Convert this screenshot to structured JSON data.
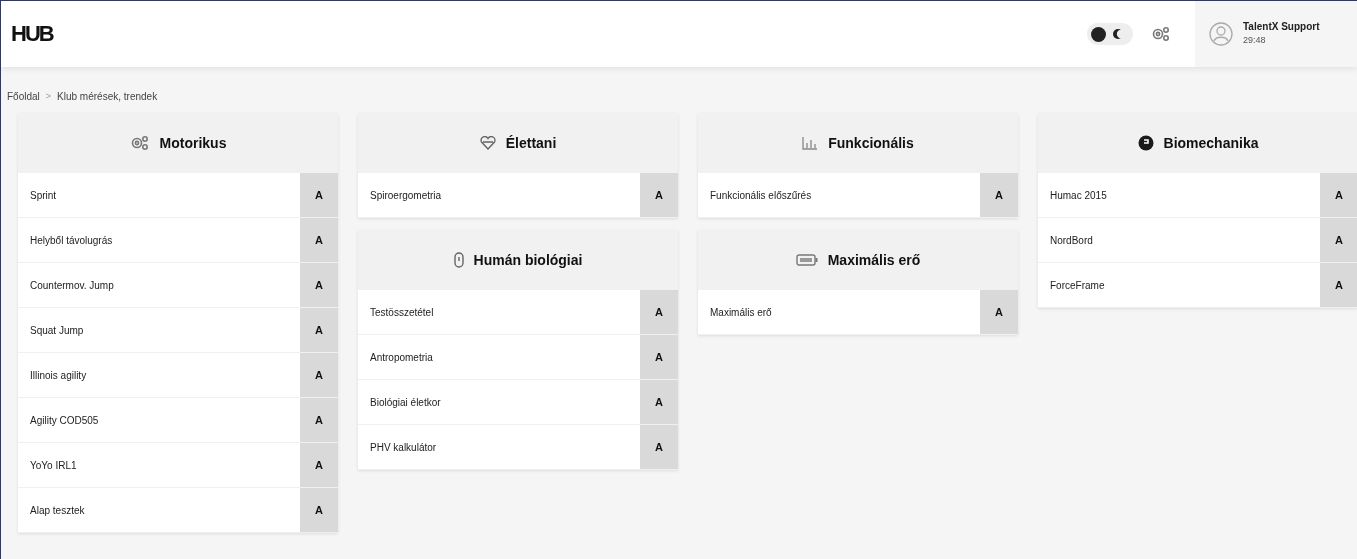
{
  "header": {
    "logo": "HUB",
    "dark_mode": false,
    "user": {
      "name": "TalentX Support",
      "time": "29:48"
    }
  },
  "breadcrumb": [
    {
      "label": "Főoldal"
    },
    {
      "label": "Klub mérések, trendek"
    }
  ],
  "breadcrumb_separator": ">",
  "columns": [
    {
      "groups": [
        {
          "title": "Motorikus",
          "kind": "gears",
          "items": [
            {
              "label": "Sprint",
              "action": "A"
            },
            {
              "label": "Helyből távolugrás",
              "action": "A"
            },
            {
              "label": "Countermov. Jump",
              "action": "A"
            },
            {
              "label": "Squat Jump",
              "action": "A"
            },
            {
              "label": "Illinois agility",
              "action": "A"
            },
            {
              "label": "Agility COD505",
              "action": "A"
            },
            {
              "label": "YoYo IRL1",
              "action": "A"
            },
            {
              "label": "Alap tesztek",
              "action": "A"
            }
          ]
        }
      ]
    },
    {
      "groups": [
        {
          "title": "Élettani",
          "kind": "heart",
          "items": [
            {
              "label": "Spiroergometria",
              "action": "A"
            }
          ]
        },
        {
          "title": "Humán biológiai",
          "kind": "capsule",
          "items": [
            {
              "label": "Testösszetétel",
              "action": "A"
            },
            {
              "label": "Antropometria",
              "action": "A"
            },
            {
              "label": "Biológiai életkor",
              "action": "A"
            },
            {
              "label": "PHV kalkulátor",
              "action": "A"
            }
          ]
        }
      ]
    },
    {
      "groups": [
        {
          "title": "Funkcionális",
          "kind": "chart",
          "items": [
            {
              "label": "Funkcionális előszűrés",
              "action": "A"
            }
          ]
        },
        {
          "title": "Maximális erő",
          "kind": "battery",
          "items": [
            {
              "label": "Maximális erő",
              "action": "A"
            }
          ]
        }
      ]
    },
    {
      "groups": [
        {
          "title": "Biomechanika",
          "kind": "disc",
          "items": [
            {
              "label": "Humac 2015",
              "action": "A"
            },
            {
              "label": "NordBord",
              "action": "A"
            },
            {
              "label": "ForceFrame",
              "action": "A"
            }
          ]
        }
      ]
    }
  ]
}
